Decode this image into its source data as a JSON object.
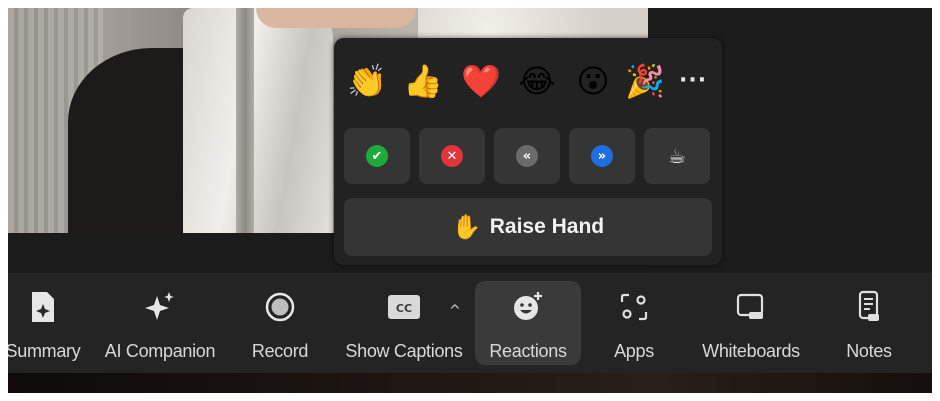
{
  "reactions_popup": {
    "emojis": [
      {
        "name": "clapping-hands",
        "glyph": "👏"
      },
      {
        "name": "thumbs-up",
        "glyph": "👍"
      },
      {
        "name": "red-heart",
        "glyph": "❤️"
      },
      {
        "name": "tears-of-joy",
        "glyph": "😂"
      },
      {
        "name": "open-mouth",
        "glyph": "😮"
      },
      {
        "name": "party-popper",
        "glyph": "🎉"
      }
    ],
    "more_label": "···",
    "feedback": [
      {
        "name": "yes",
        "glyph": "✔",
        "color": "#1faa3c"
      },
      {
        "name": "no",
        "glyph": "✕",
        "color": "#e0353d"
      },
      {
        "name": "slower",
        "glyph": "«",
        "color": "#6b6b6b"
      },
      {
        "name": "faster",
        "glyph": "»",
        "color": "#1f6fe0"
      },
      {
        "name": "coffee",
        "glyph": "☕",
        "color": "#353535"
      }
    ],
    "raise_hand": {
      "icon": "✋",
      "label": "Raise Hand"
    }
  },
  "toolbar": {
    "summary": "Summary",
    "ai_companion": "AI Companion",
    "record": "Record",
    "show_captions": "Show Captions",
    "captions_badge": "CC",
    "captions_caret": "^",
    "reactions": "Reactions",
    "apps": "Apps",
    "whiteboards": "Whiteboards",
    "notes": "Notes"
  }
}
